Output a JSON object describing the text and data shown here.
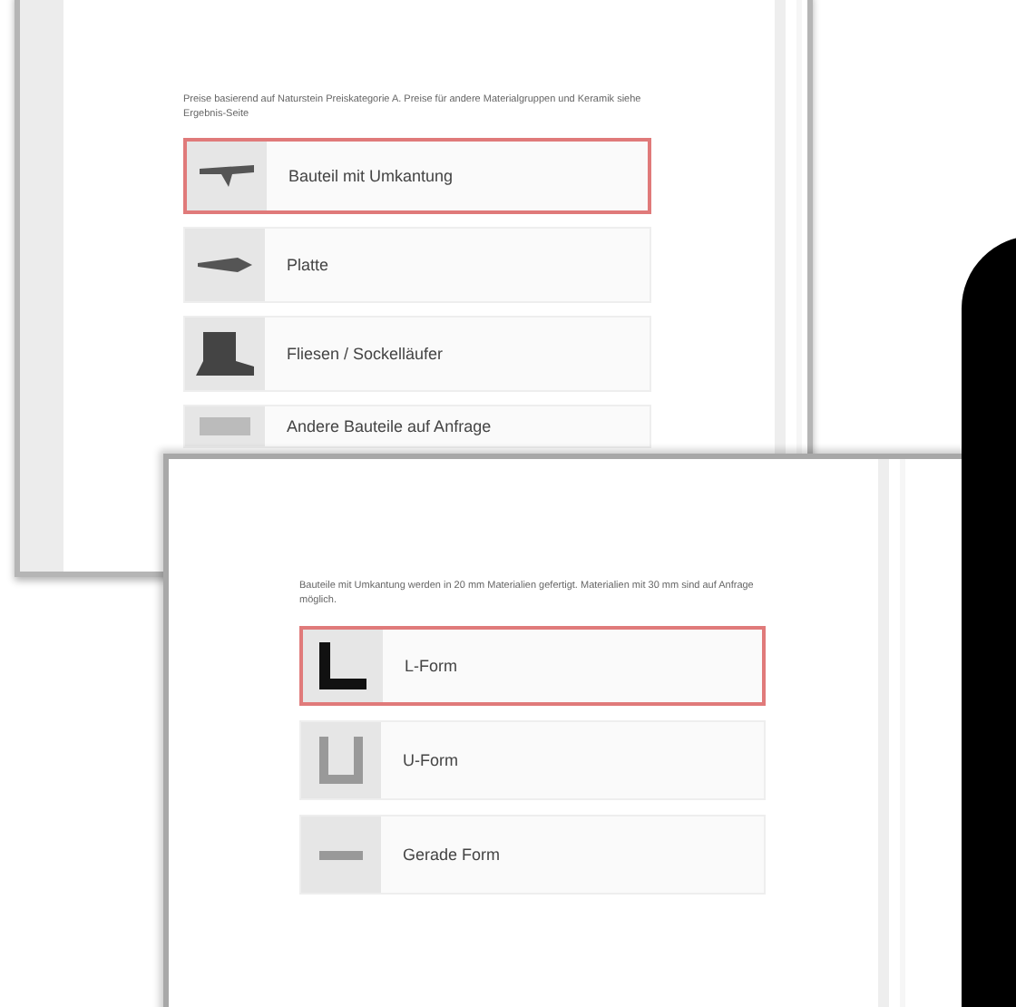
{
  "screens": [
    {
      "intro": "Preise basierend auf Naturstein Preiskategorie A. Preise für andere Materialgruppen und Keramik siehe Ergebnis-Seite",
      "options": [
        {
          "label": "Bauteil mit Umkantung",
          "selected": true,
          "kind": "edge"
        },
        {
          "label": "Platte",
          "selected": false,
          "kind": "slab"
        },
        {
          "label": "Fliesen / Sockelläufer",
          "selected": false,
          "kind": "tile"
        },
        {
          "label": "Andere Bauteile auf Anfrage",
          "selected": false,
          "kind": "other"
        }
      ]
    },
    {
      "intro": "Bauteile mit Umkantung werden in 20 mm Materialien gefertigt. Materialien mit 30 mm sind auf Anfrage möglich.",
      "options": [
        {
          "label": "L-Form",
          "selected": true,
          "kind": "l"
        },
        {
          "label": "U-Form",
          "selected": false,
          "kind": "u"
        },
        {
          "label": "Gerade Form",
          "selected": false,
          "kind": "straight"
        }
      ]
    }
  ]
}
